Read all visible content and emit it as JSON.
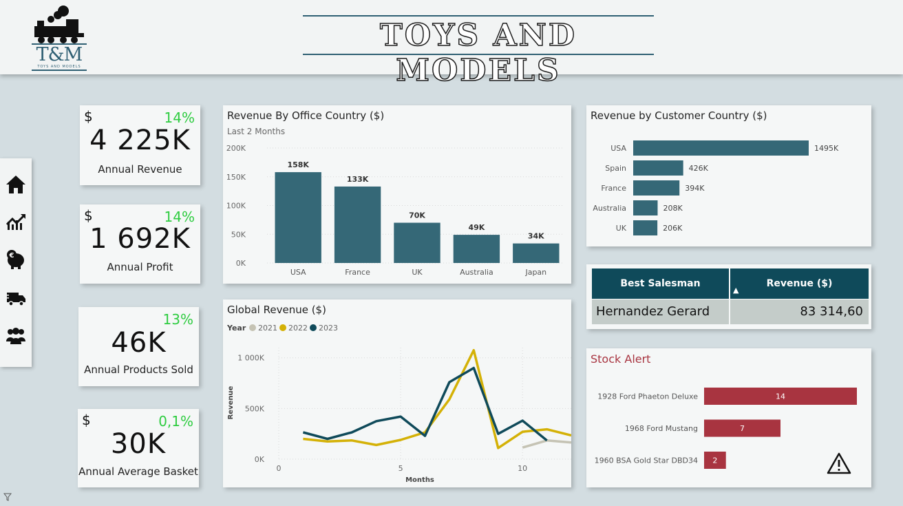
{
  "header": {
    "title": "TOYS AND MODELS",
    "logo_text": "T&M",
    "logo_subtext": "TOYS AND MODELS"
  },
  "nav": {
    "items": [
      {
        "name": "home-icon"
      },
      {
        "name": "trend-chart-icon"
      },
      {
        "name": "piggy-bank-euro-icon"
      },
      {
        "name": "delivery-truck-icon"
      },
      {
        "name": "users-group-icon"
      }
    ]
  },
  "kpis": [
    {
      "currency": "$",
      "pct": "14%",
      "value": "4 225K",
      "label": "Annual Revenue"
    },
    {
      "currency": "$",
      "pct": "14%",
      "value": "1 692K",
      "label": "Annual Profit"
    },
    {
      "currency": "",
      "pct": "13%",
      "value": "46K",
      "label": "Annual Products Sold"
    },
    {
      "currency": "$",
      "pct": "0,1%",
      "value": "30K",
      "label": "Annual Average Basket"
    }
  ],
  "office_chart": {
    "title": "Revenue By Office Country ($)",
    "subtitle": "Last 2 Months"
  },
  "customer_chart": {
    "title": "Revenue by Customer Country ($)"
  },
  "global_chart": {
    "title": "Global Revenue ($)",
    "legend_title": "Year"
  },
  "salesman_table": {
    "col1_header": "Best Salesman",
    "col2_header": "Revenue ($)",
    "sort_indicator": "▲",
    "name": "Hernandez Gerard",
    "revenue": "83 314,60"
  },
  "stock_chart": {
    "title": "Stock Alert"
  },
  "colors": {
    "teal": "#356877",
    "dark_teal": "#0f4a5a",
    "gold": "#d4b106",
    "grey": "#c5c3b4",
    "red": "#a83440",
    "green": "#2ecc40"
  },
  "chart_data": [
    {
      "id": "office",
      "type": "bar",
      "categories": [
        "USA",
        "France",
        "UK",
        "Australia",
        "Japan"
      ],
      "values": [
        158,
        133,
        70,
        49,
        34
      ],
      "data_labels": [
        "158K",
        "133K",
        "70K",
        "49K",
        "34K"
      ],
      "ylim": [
        0,
        200
      ],
      "yticks": [
        0,
        50,
        100,
        150,
        200
      ],
      "ytick_labels": [
        "0K",
        "50K",
        "100K",
        "150K",
        "200K"
      ],
      "grid": true
    },
    {
      "id": "customer",
      "type": "bar",
      "orientation": "horizontal",
      "categories": [
        "USA",
        "Spain",
        "France",
        "Australia",
        "UK"
      ],
      "values": [
        1495,
        426,
        394,
        208,
        206
      ],
      "data_labels": [
        "1495K",
        "426K",
        "394K",
        "208K",
        "206K"
      ]
    },
    {
      "id": "global",
      "type": "line",
      "xlabel": "Months",
      "ylabel": "Revenue",
      "xlim": [
        0,
        12
      ],
      "ylim": [
        0,
        1100
      ],
      "xticks": [
        0,
        5,
        10
      ],
      "yticks": [
        0,
        500,
        1000
      ],
      "ytick_labels": [
        "0K",
        "500K",
        "1 000K"
      ],
      "legend_position": "top-left",
      "series": [
        {
          "name": "2021",
          "color": "#c5c3b4",
          "x": [
            10,
            11,
            12
          ],
          "y": [
            115,
            185,
            165
          ]
        },
        {
          "name": "2022",
          "color": "#d4b106",
          "x": [
            1,
            2,
            3,
            4,
            5,
            6,
            7,
            8,
            9,
            10,
            11,
            12
          ],
          "y": [
            200,
            175,
            185,
            140,
            190,
            265,
            590,
            1075,
            110,
            270,
            295,
            235
          ]
        },
        {
          "name": "2023",
          "color": "#0f4a5a",
          "x": [
            1,
            2,
            3,
            4,
            5,
            6,
            7,
            8,
            9,
            10,
            11
          ],
          "y": [
            265,
            200,
            265,
            375,
            420,
            230,
            760,
            900,
            250,
            380,
            185
          ]
        }
      ]
    },
    {
      "id": "stock",
      "type": "bar",
      "orientation": "horizontal",
      "categories": [
        "1928 Ford Phaeton Deluxe",
        "1968 Ford Mustang",
        "1960 BSA Gold Star DBD34"
      ],
      "values": [
        14,
        7,
        2
      ],
      "data_labels": [
        "14",
        "7",
        "2"
      ]
    }
  ]
}
